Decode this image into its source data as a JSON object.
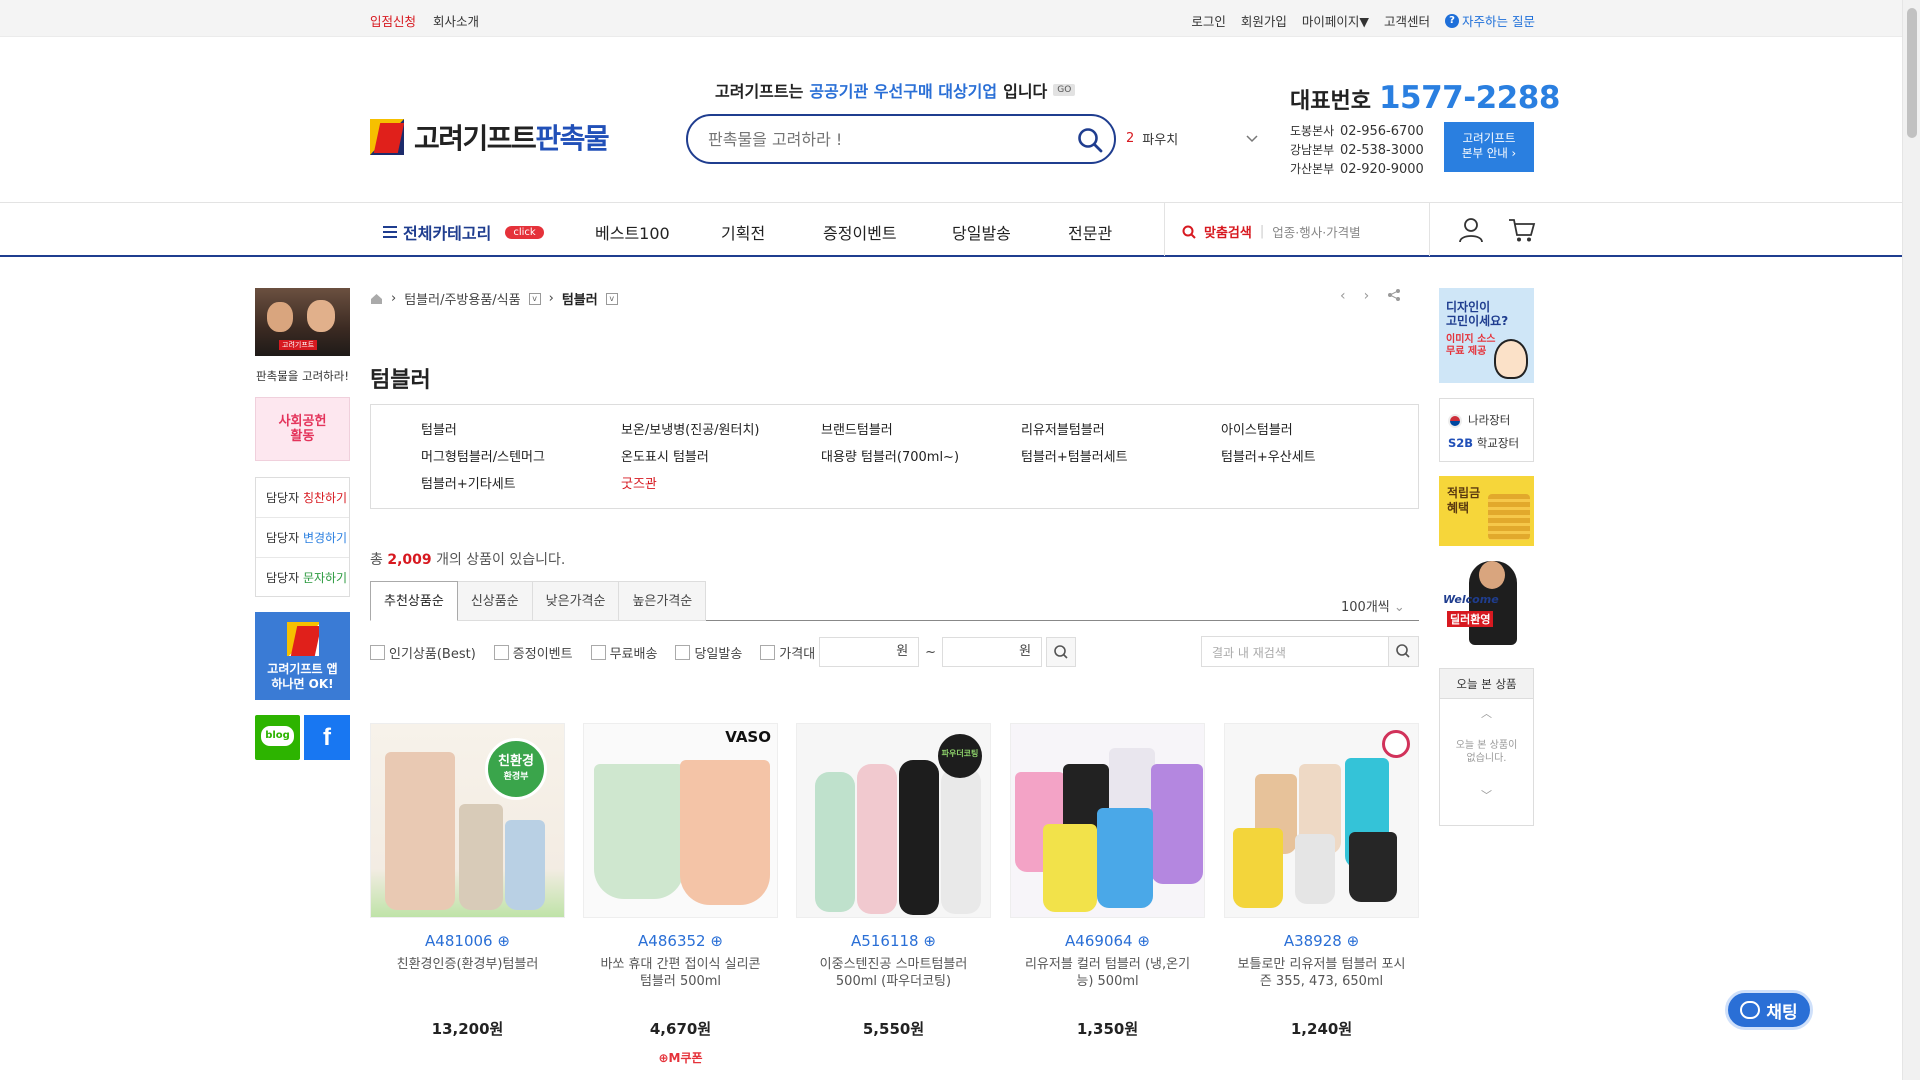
{
  "topbar": {
    "left": [
      "입점신청",
      "회사소개"
    ],
    "right": [
      "로그인",
      "회원가입",
      "마이페이지▼",
      "고객센터"
    ],
    "faq": "자주하는 질문"
  },
  "header": {
    "logo_black": "고려기프트",
    "logo_blue": "판촉물",
    "slogan_pre": "고려기프트는",
    "slogan_hl": "공공기관 우선구매 대상기업",
    "slogan_post": "입니다",
    "slogan_go": "GO",
    "search_placeholder": "판촉물을 고려하라 !",
    "hot_rank": "2",
    "hot_keyword": "파우치",
    "rep_label": "대표번호",
    "rep_number": "1577-2288",
    "branches": [
      {
        "name": "도봉본사",
        "phone": "02-956-6700"
      },
      {
        "name": "강남본부",
        "phone": "02-538-3000"
      },
      {
        "name": "가산본부",
        "phone": "02-920-9000"
      }
    ],
    "branch_btn_1": "고려기프트",
    "branch_btn_2": "본부 안내 ›"
  },
  "nav": {
    "all_categories": "전체카테고리",
    "click_badge": "click",
    "menu": [
      "베스트100",
      "기획전",
      "증정이벤트",
      "당일발송",
      "전문관"
    ],
    "custom_search": "맞춤검색",
    "custom_hint": "업종·행사·가격별"
  },
  "left_sidebar": {
    "video_badge": "고려기프트",
    "caption": "판촉물을 고려하라!",
    "social_1": "사회공헌",
    "social_2": "활동",
    "managers": [
      {
        "pre": "담당자 ",
        "hl": "칭찬하기"
      },
      {
        "pre": "담당자 ",
        "hl": "변경하기"
      },
      {
        "pre": "담당자 ",
        "hl": "문자하기"
      }
    ],
    "app_1": "고려기프트 앱",
    "app_2": "하나면 OK!",
    "blog": "blog",
    "facebook": "f"
  },
  "right_sidebar": {
    "design_1": "디자인이",
    "design_2": "고민이세요?",
    "design_3": "이미지 소스",
    "design_4": "무료 제공",
    "nara": "나라장터",
    "s2b": "S2B",
    "school": "학교장터",
    "points_1": "적립금",
    "points_2": "혜택",
    "welcome_1": "Welcome",
    "welcome_2": "딜러환영",
    "recent_title": "오늘 본 상품",
    "recent_msg_1": "오늘 본 상품이",
    "recent_msg_2": "없습니다."
  },
  "breadcrumb": {
    "level1": "텀블러/주방용품/식품",
    "level2": "텀블러"
  },
  "page_title": "텀블러",
  "subcategories": [
    "텀블러",
    "보온/보냉병(진공/원터치)",
    "브랜드텀블러",
    "리유저블텀블러",
    "아이스텀블러",
    "머그형텀블러/스텐머그",
    "온도표시 텀블러",
    "대용량 텀블러(700ml~)",
    "텀블러+텀블러세트",
    "텀블러+우산세트",
    "텀블러+기타세트",
    "굿즈관"
  ],
  "total": {
    "pre": "총 ",
    "count": "2,009",
    "post": " 개의 상품이 있습니다."
  },
  "sort_tabs": [
    "추천상품순",
    "신상품순",
    "낮은가격순",
    "높은가격순"
  ],
  "per_page": "100개씩",
  "filters": {
    "checks": [
      "인기상품(Best)",
      "증정이벤트",
      "무료배송",
      "당일발송",
      "가격대"
    ],
    "price_unit": "원",
    "tilde": "~",
    "result_placeholder": "결과 내 재검색"
  },
  "products": [
    {
      "code": "A481006",
      "name": "친환경인증(환경부)텀블러",
      "price": "13,200원",
      "coupon": ""
    },
    {
      "code": "A486352",
      "name": "바쏘 휴대 간편 접이식 실리콘 텀블러 500ml",
      "price": "4,670원",
      "coupon": "M쿠폰"
    },
    {
      "code": "A516118",
      "name": "이중스텐진공 스마트텀블러 500ml (파우더코팅)",
      "price": "5,550원",
      "coupon": ""
    },
    {
      "code": "A469064",
      "name": "리유저블 컬러 텀블러 (냉,온기능) 500ml",
      "price": "1,350원",
      "coupon": ""
    },
    {
      "code": "A38928",
      "name": "보틀로만 리유저블 텀블러 포시즌 355, 473, 650ml",
      "price": "1,240원",
      "coupon": ""
    }
  ],
  "product_badges": {
    "eco": "친환경",
    "eco_sub": "환경부",
    "vaso": "VASO",
    "powder": "파우더코팅"
  },
  "chat": "채팅"
}
